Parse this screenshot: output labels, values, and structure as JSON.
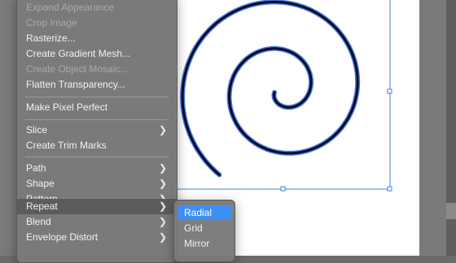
{
  "menu": {
    "items": [
      {
        "label": "Expand Appearance",
        "disabled": true
      },
      {
        "label": "Crop Image",
        "disabled": true
      },
      {
        "label": "Rasterize...",
        "disabled": false
      },
      {
        "label": "Create Gradient Mesh...",
        "disabled": false
      },
      {
        "label": "Create Object Mosaic...",
        "disabled": true
      },
      {
        "label": "Flatten Transparency...",
        "disabled": false
      },
      {
        "label": "Make Pixel Perfect",
        "disabled": false
      },
      {
        "label": "Slice",
        "disabled": false,
        "submenu": true
      },
      {
        "label": "Create Trim Marks",
        "disabled": false
      },
      {
        "label": "Path",
        "disabled": false,
        "submenu": true
      },
      {
        "label": "Shape",
        "disabled": false,
        "submenu": true
      },
      {
        "label": "Pattern",
        "disabled": false,
        "submenu": true
      },
      {
        "label": "Repeat",
        "disabled": false,
        "submenu": true,
        "highlighted": true
      },
      {
        "label": "Blend",
        "disabled": false,
        "submenu": true
      },
      {
        "label": "Envelope Distort",
        "disabled": false,
        "submenu": true
      }
    ],
    "chevron_icon": "chevron-right-icon"
  },
  "submenu": {
    "items": [
      {
        "label": "Radial",
        "selected": true
      },
      {
        "label": "Grid",
        "selected": false
      },
      {
        "label": "Mirror",
        "selected": false
      }
    ]
  },
  "colors": {
    "menu_bg": "#7a7a7a",
    "selection_accent": "#3d8ff5",
    "bounding_box": "#4a7bd9",
    "spiral_stroke": "#0b0b2a"
  }
}
